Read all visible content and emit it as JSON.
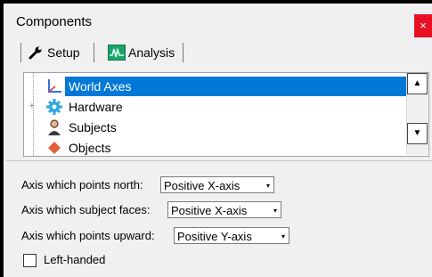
{
  "window": {
    "title": "Components",
    "close_label": "×"
  },
  "tabs": [
    {
      "label": "Setup",
      "icon": "wrench-icon",
      "selected": true
    },
    {
      "label": "Analysis",
      "icon": "waveform-icon",
      "selected": false
    }
  ],
  "tree": {
    "items": [
      {
        "label": "World Axes",
        "icon": "axes-icon",
        "selected": true
      },
      {
        "label": "Hardware",
        "icon": "gear-icon",
        "expand": "+"
      },
      {
        "label": "Subjects",
        "icon": "person-icon"
      },
      {
        "label": "Objects",
        "icon": "object-icon"
      }
    ],
    "scroll_up": "▲",
    "scroll_down": "▼"
  },
  "settings": {
    "north_label": "Axis which points north:",
    "north_value": "Positive X-axis",
    "faces_label": "Axis which subject faces:",
    "faces_value": "Positive X-axis",
    "upward_label": "Axis which points upward:",
    "upward_value": "Positive Y-axis",
    "left_handed_label": "Left-handed",
    "left_handed_checked": false,
    "dropdown_arrow": "▾"
  },
  "colors": {
    "selection": "#0078d7",
    "close": "#e81123",
    "panel": "#f0f0f0"
  }
}
